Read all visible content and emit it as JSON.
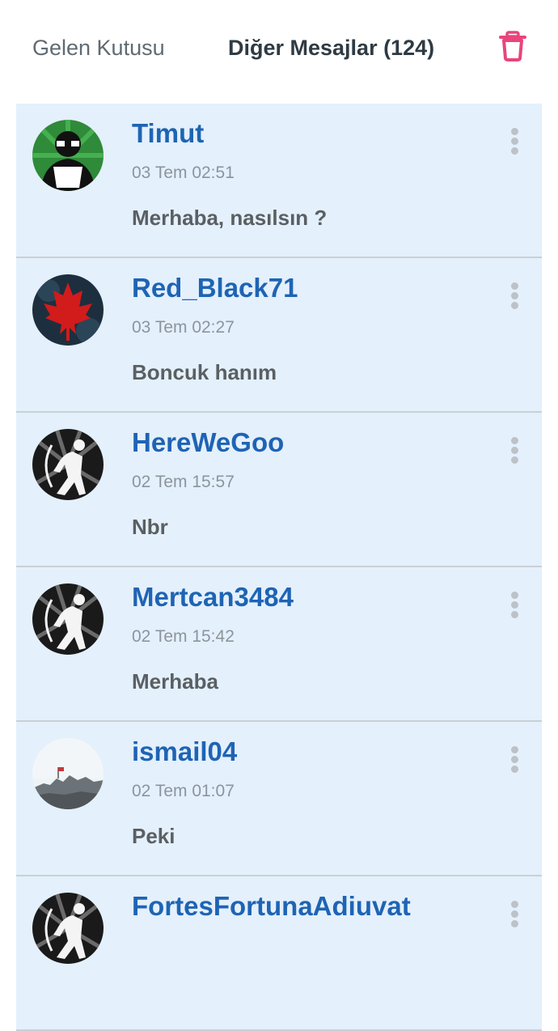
{
  "header": {
    "inbox_tab": "Gelen Kutusu",
    "other_tab": "Diğer Mesajlar (124)",
    "trash_icon": "trash-icon",
    "trash_color": "#e8457c"
  },
  "messages": [
    {
      "username": "Timut",
      "time": "03 Tem 02:51",
      "preview": "Merhaba, nasılsın ?",
      "avatar": "hacker-avatar"
    },
    {
      "username": "Red_Black71",
      "time": "03 Tem 02:27",
      "preview": "Boncuk hanım",
      "avatar": "maple-leaf-avatar"
    },
    {
      "username": "HereWeGoo",
      "time": "02 Tem 15:57",
      "preview": "Nbr",
      "avatar": "archer-avatar"
    },
    {
      "username": "Mertcan3484",
      "time": "02 Tem 15:42",
      "preview": "Merhaba",
      "avatar": "archer-avatar"
    },
    {
      "username": "ismail04",
      "time": "02 Tem 01:07",
      "preview": "Peki",
      "avatar": "castle-avatar"
    },
    {
      "username": "FortesFortunaAdiuvat",
      "time": "",
      "preview": "",
      "avatar": "archer-avatar"
    }
  ],
  "colors": {
    "username": "#1e64b4",
    "row_background": "#e4f0fc",
    "accent": "#e8457c"
  }
}
